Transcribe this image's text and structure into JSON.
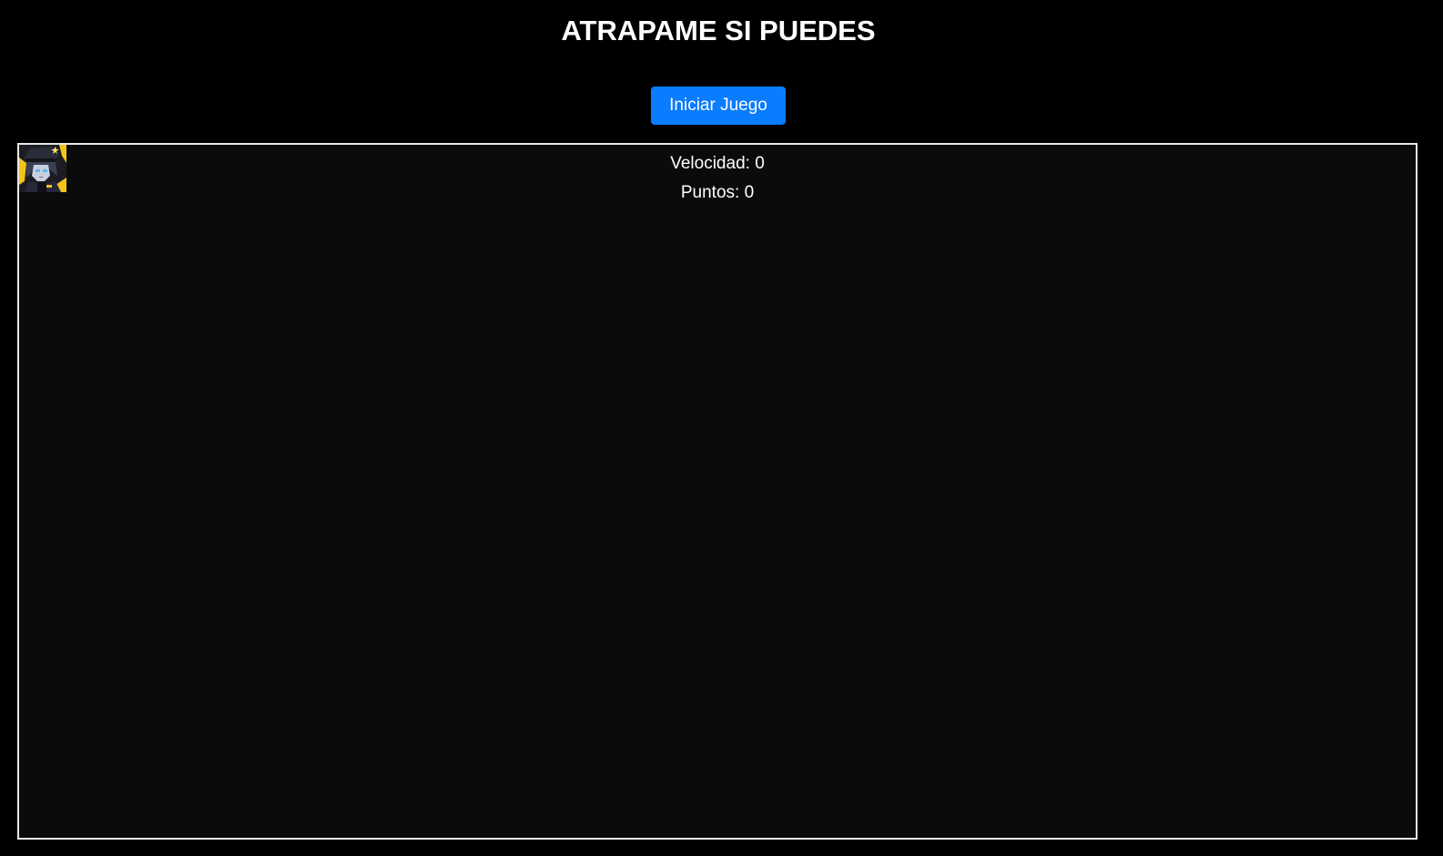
{
  "header": {
    "title": "ATRAPAME SI PUEDES"
  },
  "controls": {
    "start_label": "Iniciar Juego"
  },
  "game": {
    "speed_text": "Velocidad: 0",
    "points_text": "Puntos: 0",
    "speed_value": 0,
    "points_value": 0,
    "character_icon": "anime-character-avatar-icon"
  },
  "colors": {
    "background": "#000000",
    "game_area": "#0b0b0b",
    "border": "#e8e8e8",
    "button": "#0a7cff",
    "text": "#ffffff",
    "character_accent": "#f2c41a"
  }
}
